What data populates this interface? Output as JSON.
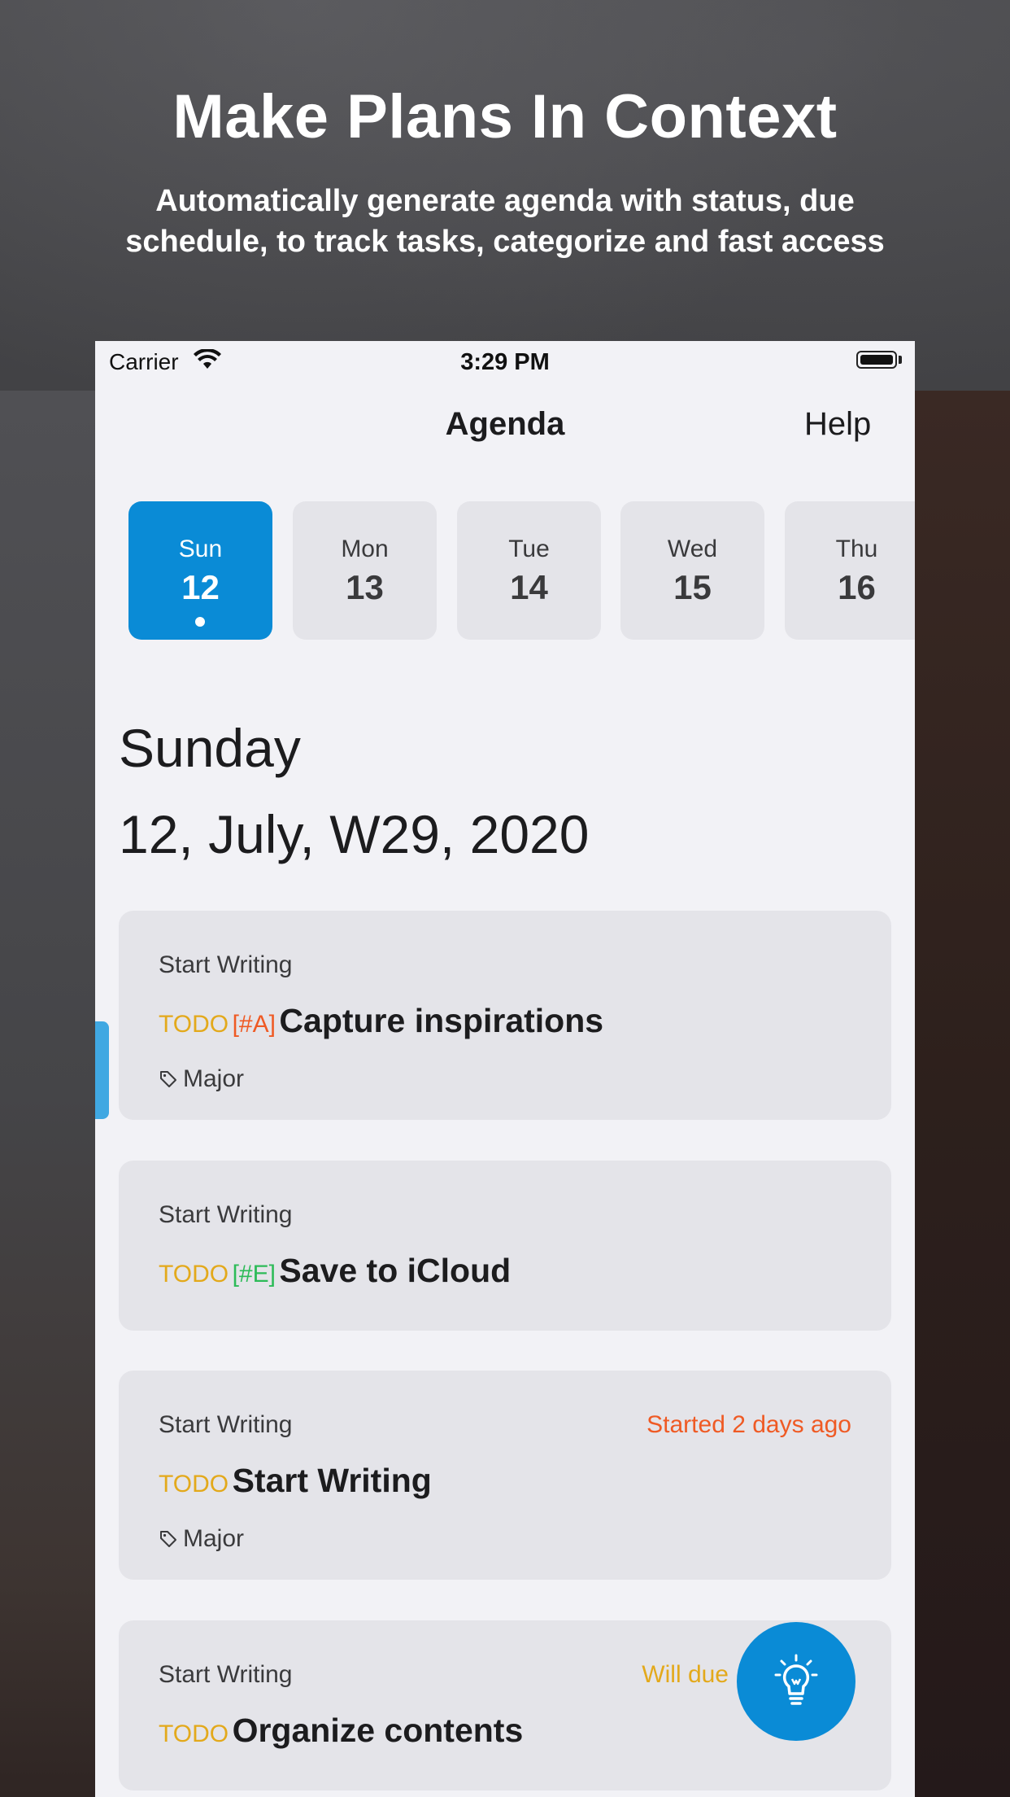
{
  "header": {
    "title": "Make Plans In Context",
    "subtitle": "Automatically generate agenda with status, due schedule, to track tasks, categorize and fast access"
  },
  "status_bar": {
    "carrier": "Carrier",
    "time": "3:29 PM"
  },
  "nav": {
    "title": "Agenda",
    "help": "Help"
  },
  "days": [
    {
      "name": "Sun",
      "num": "12",
      "active": true
    },
    {
      "name": "Mon",
      "num": "13"
    },
    {
      "name": "Tue",
      "num": "14"
    },
    {
      "name": "Wed",
      "num": "15"
    },
    {
      "name": "Thu",
      "num": "16"
    }
  ],
  "date": {
    "weekday": "Sunday",
    "full": "12, July,  W29, 2020"
  },
  "cards": [
    {
      "project": "Start Writing",
      "todo": "TODO",
      "priority": "[#A]",
      "task": "Capture inspirations",
      "tag": "Major",
      "meta": ""
    },
    {
      "project": "Start Writing",
      "todo": "TODO",
      "priority": "[#E]",
      "task": "Save to iCloud",
      "tag": "",
      "meta": ""
    },
    {
      "project": "Start Writing",
      "todo": "TODO",
      "priority": "",
      "task": "Start Writing",
      "tag": "Major",
      "meta": "Started 2 days ago"
    },
    {
      "project": "Start Writing",
      "todo": "TODO",
      "priority": "",
      "task": "Organize contents",
      "tag": "",
      "meta": "Will due"
    }
  ],
  "colors": {
    "accent": "#0a8bd6",
    "todo": "#e3a91b",
    "priority_a": "#ef5a24",
    "priority_e": "#2dbb58",
    "started": "#ef5a24",
    "will_due": "#e3a91b"
  },
  "icons": {
    "fab": "lightbulb-icon",
    "tag": "tag-icon",
    "wifi": "wifi-icon",
    "battery": "battery-icon"
  }
}
